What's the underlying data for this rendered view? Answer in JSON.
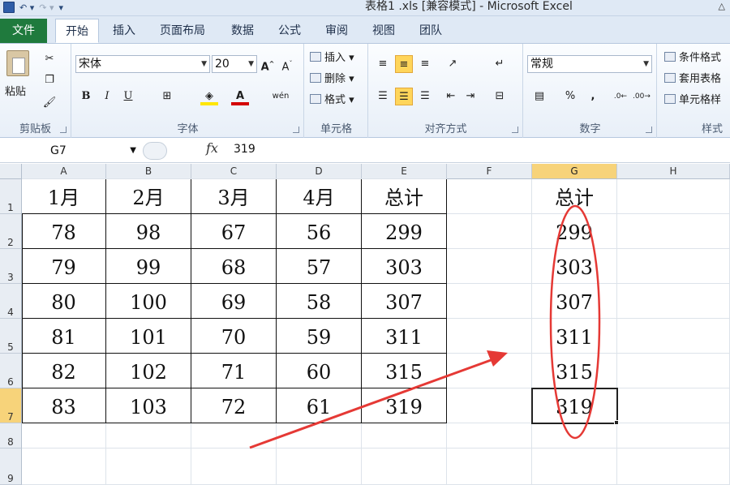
{
  "window": {
    "title": "表格1 .xls  [兼容模式]  -  Microsoft Excel"
  },
  "ribbon_tabs": {
    "file": "文件",
    "items": [
      "开始",
      "插入",
      "页面布局",
      "数据",
      "公式",
      "审阅",
      "视图",
      "团队"
    ],
    "active": "开始"
  },
  "ribbon": {
    "clipboard": {
      "paste": "粘贴",
      "label": "剪贴板"
    },
    "font": {
      "name": "宋体",
      "size": "20",
      "label": "字体",
      "bold": "B",
      "italic": "I",
      "underline": "U"
    },
    "cells": {
      "insert": "插入",
      "delete": "删除",
      "format": "格式",
      "label": "单元格"
    },
    "alignment": {
      "label": "对齐方式"
    },
    "number": {
      "format": "常规",
      "percent": "%",
      "comma": ",",
      "label": "数字"
    },
    "styles": {
      "conditional": "条件格式",
      "table": "套用表格",
      "cell": "单元格样",
      "label": "样式"
    }
  },
  "formula_bar": {
    "name_box": "G7",
    "fx": "fx",
    "value": "319"
  },
  "sheet": {
    "columns": [
      "A",
      "B",
      "C",
      "D",
      "E",
      "F",
      "G",
      "H"
    ],
    "rows": [
      "1",
      "2",
      "3",
      "4",
      "5",
      "6",
      "7",
      "8",
      "9"
    ],
    "selected_cell": "G7",
    "table_header": [
      "1月",
      "2月",
      "3月",
      "4月",
      "总计"
    ],
    "table_rows": [
      [
        "78",
        "98",
        "67",
        "56",
        "299"
      ],
      [
        "79",
        "99",
        "68",
        "57",
        "303"
      ],
      [
        "80",
        "100",
        "69",
        "58",
        "307"
      ],
      [
        "81",
        "101",
        "70",
        "59",
        "311"
      ],
      [
        "82",
        "102",
        "71",
        "60",
        "315"
      ],
      [
        "83",
        "103",
        "72",
        "61",
        "319"
      ]
    ],
    "g_column": [
      "总计",
      "299",
      "303",
      "307",
      "311",
      "315",
      "319"
    ]
  },
  "annotations": {
    "color": "#e53935"
  }
}
